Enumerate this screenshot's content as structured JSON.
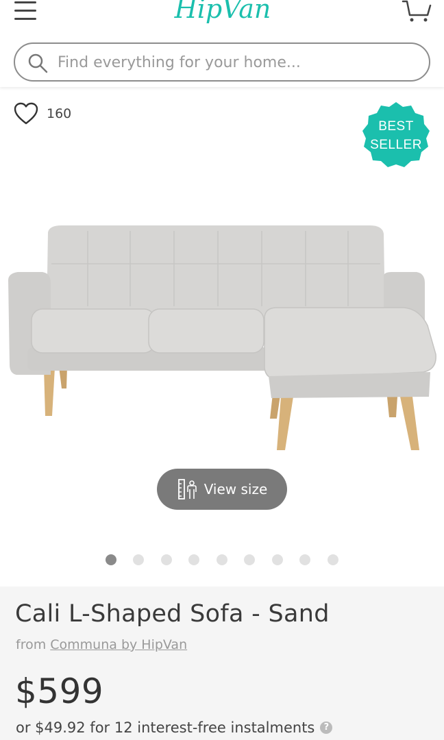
{
  "header": {
    "logo_text": "HipVan",
    "search": {
      "placeholder": "Find everything for your home...",
      "value": ""
    }
  },
  "gallery": {
    "likes_count": "160",
    "badge": {
      "line1": "BEST",
      "line2": "SELLER"
    },
    "view_size_label": "View size",
    "slide_count": 9,
    "active_slide": 1
  },
  "product": {
    "title": "Cali L-Shaped Sofa - Sand",
    "from_prefix": "from",
    "brand": "Communa by HipVan",
    "price": "$599",
    "instalment_text": "or $49.92 for 12 interest-free instalments",
    "help_symbol": "?"
  },
  "colors": {
    "brand_teal": "#1bbfad",
    "sofa_fabric": "#d6d5d3",
    "wood_legs": "#d7b27a"
  }
}
